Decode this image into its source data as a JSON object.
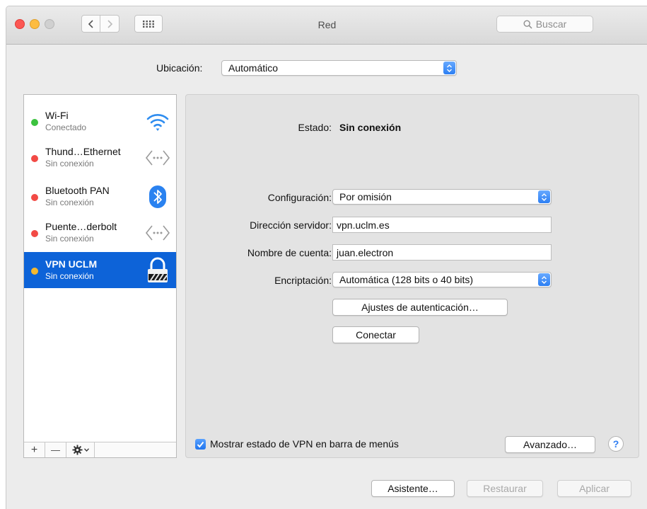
{
  "window": {
    "title": "Red",
    "search_placeholder": "Buscar"
  },
  "location": {
    "label": "Ubicación:",
    "value": "Automático"
  },
  "services": [
    {
      "name": "Wi-Fi",
      "status": "Conectado",
      "status_color": "#3cc23f",
      "icon": "wifi-icon"
    },
    {
      "name": "Thund…Ethernet",
      "status": "Sin conexión",
      "status_color": "#f24a45",
      "icon": "ethernet-icon"
    },
    {
      "name": "Bluetooth PAN",
      "status": "Sin conexión",
      "status_color": "#f24a45",
      "icon": "bluetooth-icon"
    },
    {
      "name": "Puente…derbolt",
      "status": "Sin conexión",
      "status_color": "#f24a45",
      "icon": "ethernet-icon"
    },
    {
      "name": "VPN UCLM",
      "status": "Sin conexión",
      "status_color": "#f5b92f",
      "icon": "vpn-lock-icon",
      "selected": true
    }
  ],
  "sidebar_tools": {
    "add": "+",
    "remove": "—"
  },
  "detail": {
    "estado_label": "Estado:",
    "estado_value": "Sin conexión",
    "config_label": "Configuración:",
    "config_value": "Por omisión",
    "server_label": "Dirección servidor:",
    "server_value": "vpn.uclm.es",
    "account_label": "Nombre de cuenta:",
    "account_value": "juan.electron",
    "encrypt_label": "Encriptación:",
    "encrypt_value": "Automática (128 bits o 40 bits)",
    "auth_button": "Ajustes de autenticación…",
    "connect_button": "Conectar",
    "show_vpn_label": "Mostrar estado de VPN en barra de menús",
    "show_vpn_checked": true,
    "advanced_button": "Avanzado…",
    "help_label": "?"
  },
  "footer": {
    "assistant_button": "Asistente…",
    "revert_button": "Restaurar",
    "apply_button": "Aplicar"
  },
  "colors": {
    "accent": "#0d63d8"
  }
}
